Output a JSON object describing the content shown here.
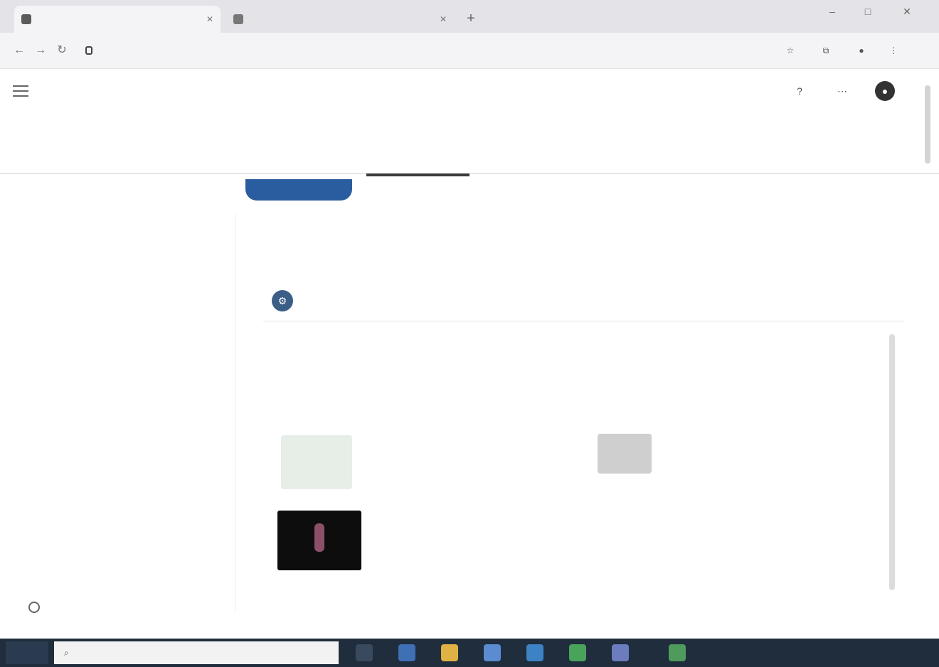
{
  "browser": {
    "tabs": [
      {
        "title": "",
        "active": true
      },
      {
        "title": "",
        "active": false
      }
    ],
    "omnibox_url": "",
    "window_controls": [
      "–",
      "□",
      "✕"
    ]
  },
  "header": {
    "breadcrumb": [],
    "icons": [
      "help-icon",
      "apps-icon",
      "avatar"
    ]
  },
  "tabs_top": [],
  "subtabs": [],
  "sidebar": {
    "items": [],
    "bottom_label": ""
  },
  "main": {
    "title": "",
    "row": {
      "text": "",
      "right": ""
    },
    "paragraph": [],
    "items": [],
    "bottom_link": ""
  },
  "taskbar": {
    "search_placeholder": "",
    "tray_text": ""
  },
  "colors": {
    "accent_blue": "#2a5d9f",
    "taskbar": "#1f2d3d",
    "thumb_dark": "#0d0d0d"
  }
}
